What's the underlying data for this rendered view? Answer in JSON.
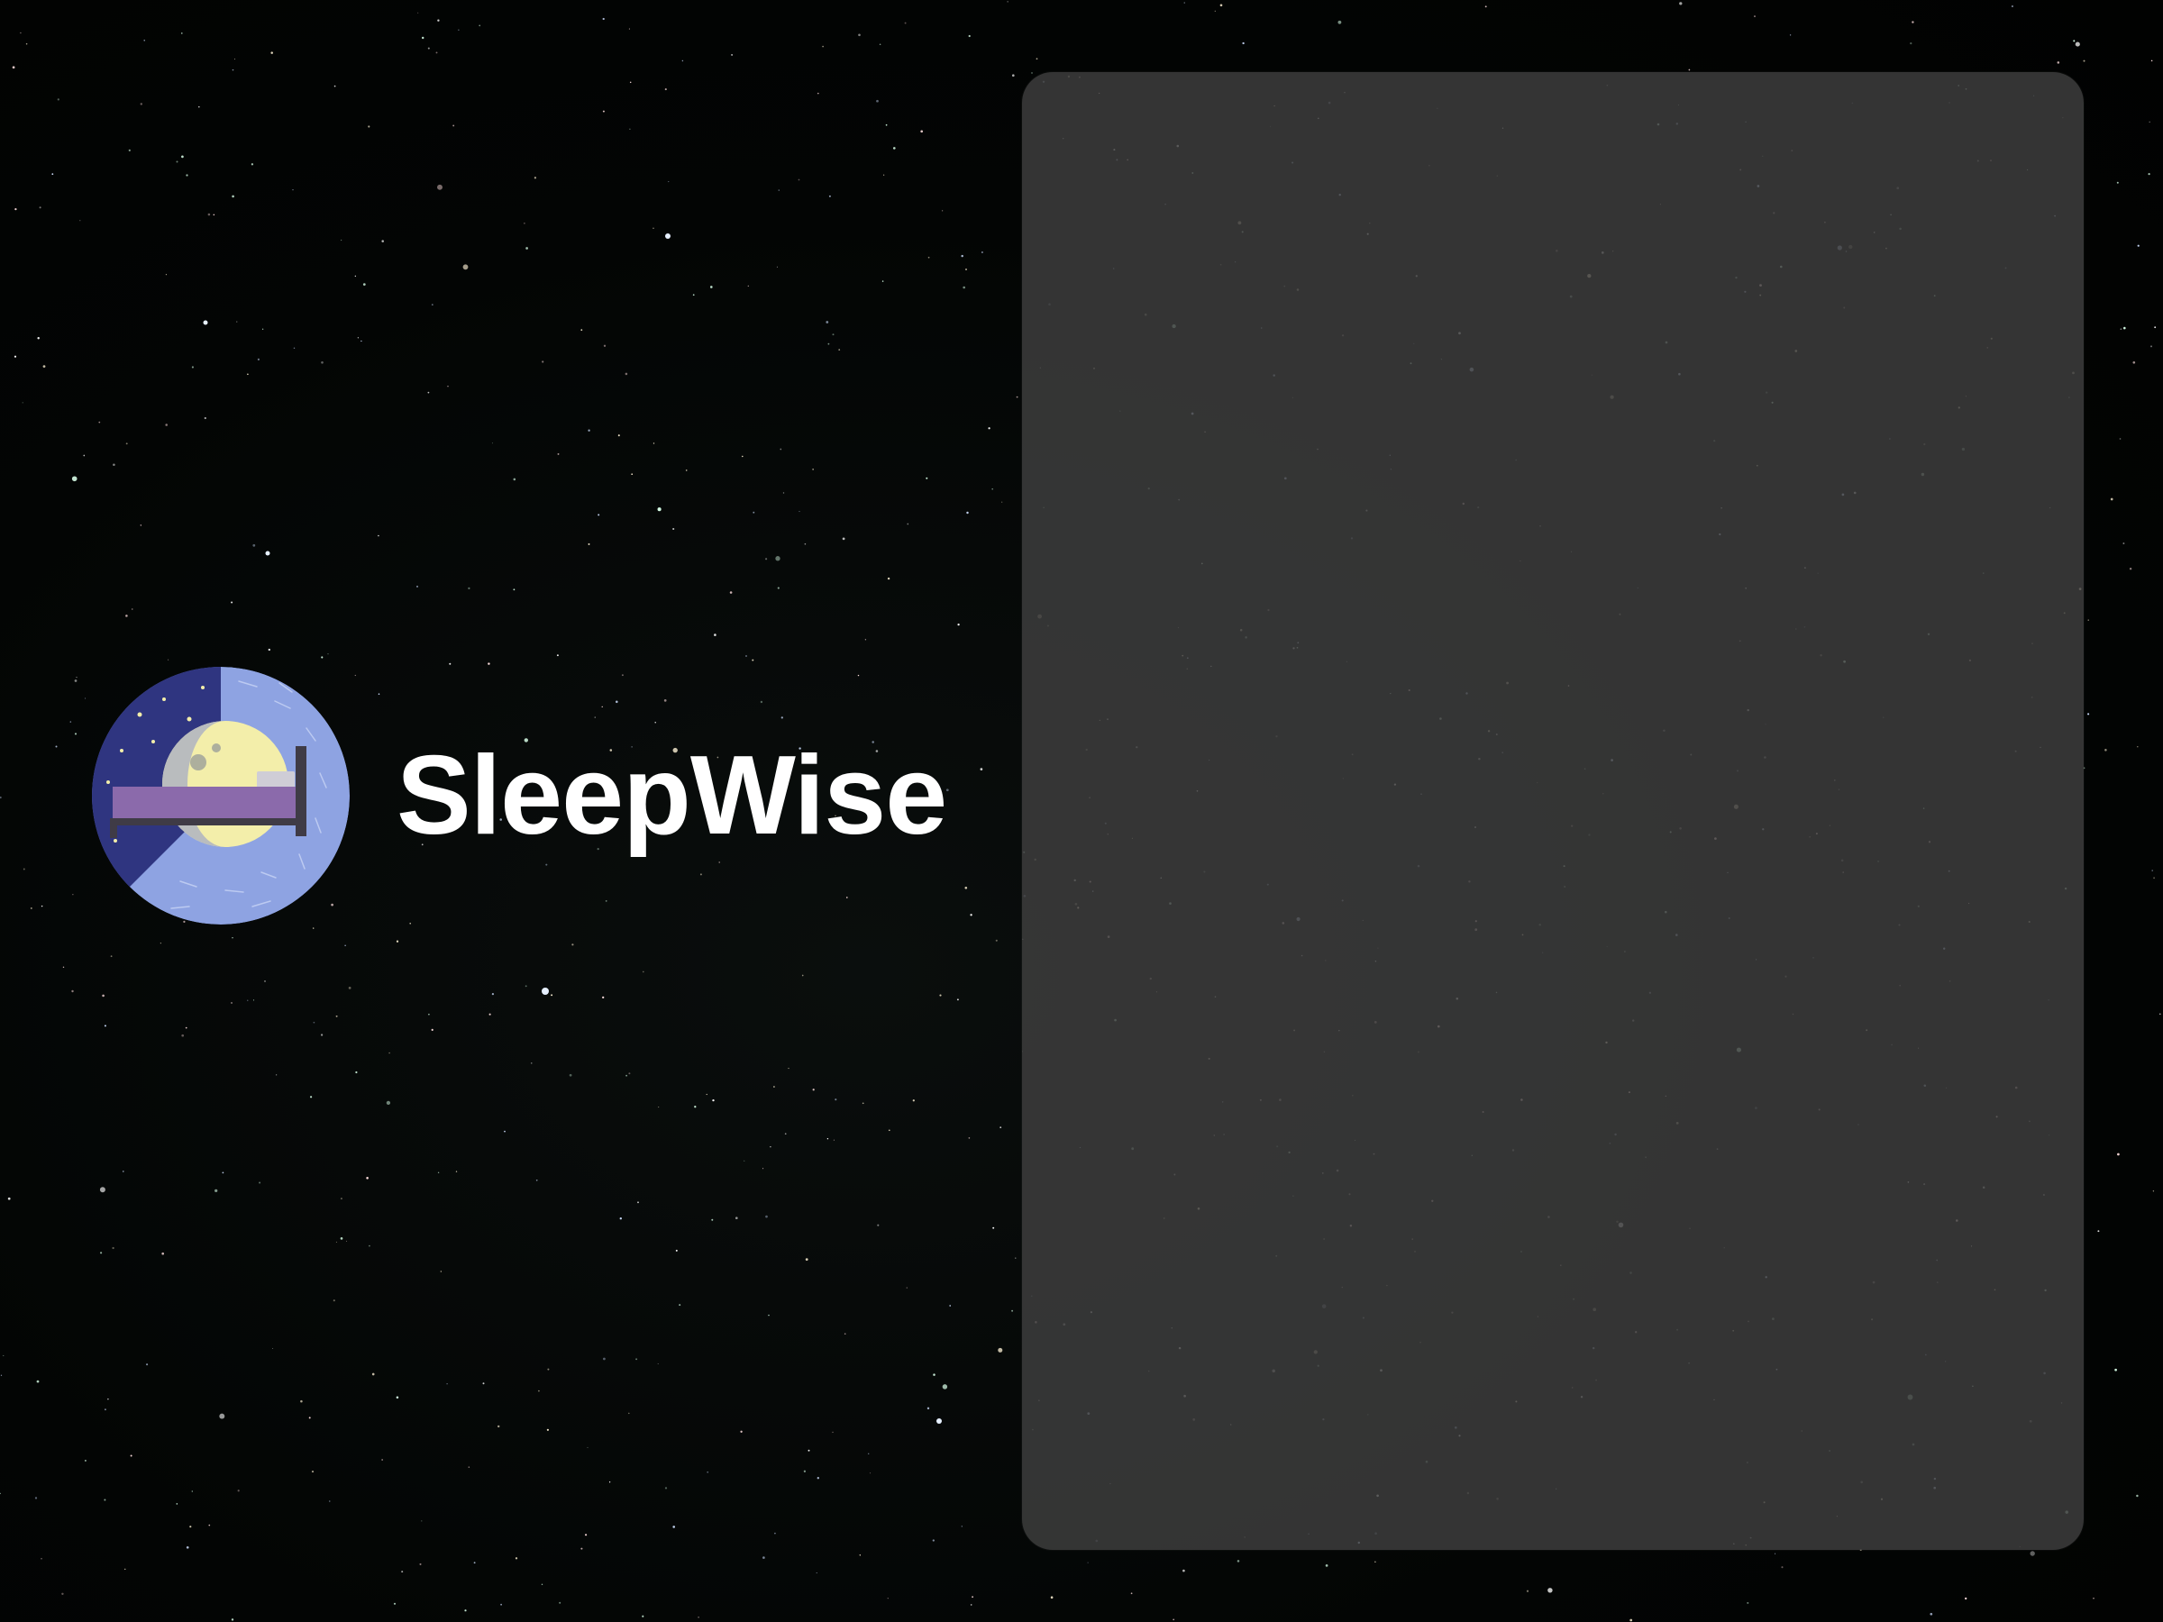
{
  "app": {
    "name": "SleepWise",
    "logo_icon": "moon-bed-logo-icon"
  },
  "colors": {
    "background": "#020403",
    "panel": "#3e3e3e",
    "logo_dark_blue": "#2f3580",
    "logo_light_blue": "#8ea3e2",
    "moon": "#f3eeaa",
    "bed": "#8b6aab",
    "text": "#ffffff"
  },
  "content_panel": {
    "items": []
  }
}
